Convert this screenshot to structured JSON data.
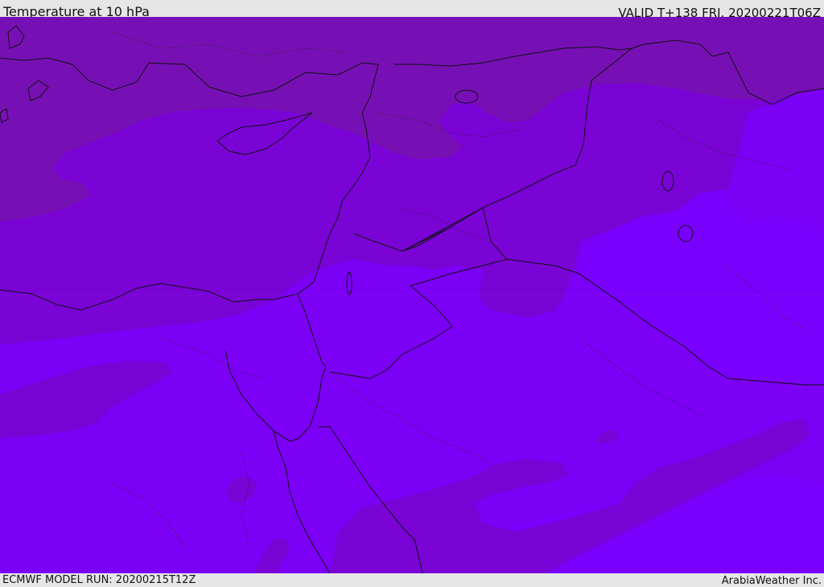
{
  "header": {
    "title": "Temperature at 10 hPa",
    "valid_time": "VALID T+138 FRI. 20200221T06Z"
  },
  "footer": {
    "model_run": "ECMWF MODEL RUN: 20200215T12Z",
    "credit": "ArabiaWeather Inc."
  },
  "map": {
    "region": "Eastern Mediterranean and Middle East",
    "colors": {
      "band_warm": "#7710b4",
      "band_mid": "#7a03d6",
      "band_cool": "#7c00f6",
      "band_coolest": "#7a00fe",
      "borders": "#111111",
      "frame_background": "#e6e6e6"
    }
  }
}
